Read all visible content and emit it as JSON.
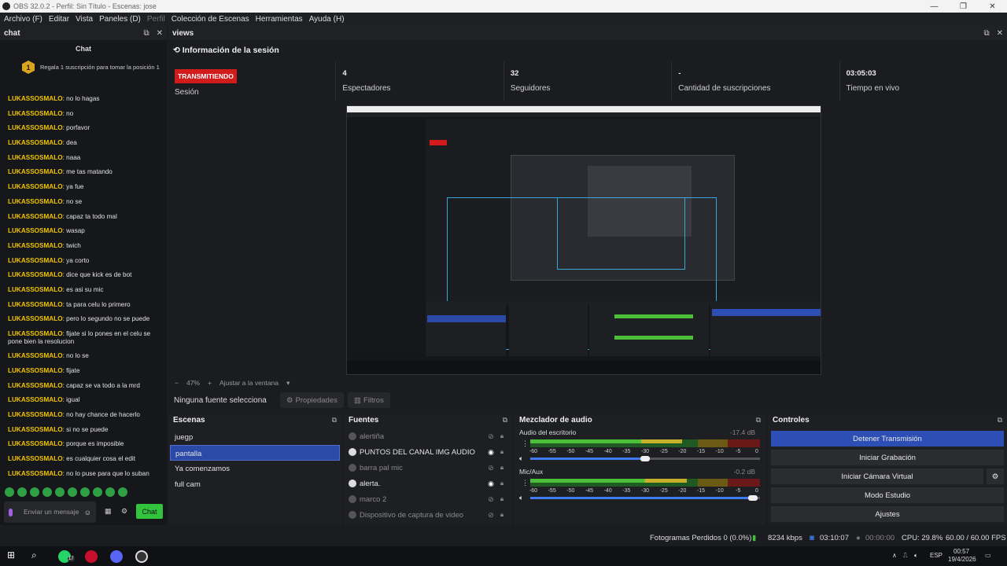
{
  "window": {
    "title": "OBS 32.0.2 - Perfil: Sin Título - Escenas: jose"
  },
  "menu": [
    "Archivo (F)",
    "Editar",
    "Vista",
    "Paneles (D)",
    "Perfil",
    "Colección de Escenas",
    "Herramientas",
    "Ayuda (H)"
  ],
  "chat_dock": {
    "header": "chat",
    "title": "Chat",
    "sub_banner": "Regala 1 suscripción para tomar la posición 1",
    "sub_rank": "1",
    "messages": [
      {
        "user": "LUKASSOSMALO",
        "text": ": no lo hagas"
      },
      {
        "user": "LUKASSOSMALO",
        "text": ": no"
      },
      {
        "user": "LUKASSOSMALO",
        "text": ": porfavor"
      },
      {
        "user": "LUKASSOSMALO",
        "text": ": dea"
      },
      {
        "user": "LUKASSOSMALO",
        "text": ": naaa"
      },
      {
        "user": "LUKASSOSMALO",
        "text": ": me tas matando"
      },
      {
        "user": "LUKASSOSMALO",
        "text": ": ya fue"
      },
      {
        "user": "LUKASSOSMALO",
        "text": ": no se"
      },
      {
        "user": "LUKASSOSMALO",
        "text": ": capaz ta todo mal"
      },
      {
        "user": "LUKASSOSMALO",
        "text": ": wasap"
      },
      {
        "user": "LUKASSOSMALO",
        "text": ": twich"
      },
      {
        "user": "LUKASSOSMALO",
        "text": ": ya corto"
      },
      {
        "user": "LUKASSOSMALO",
        "text": ": dice que kick es de bot"
      },
      {
        "user": "LUKASSOSMALO",
        "text": ": es asi su mic"
      },
      {
        "user": "LUKASSOSMALO",
        "text": ": ta para celu lo primero"
      },
      {
        "user": "LUKASSOSMALO",
        "text": ": pero lo segundo no se puede"
      },
      {
        "user": "LUKASSOSMALO",
        "text": ": fijate si lo pones en el celu se pone bien la resolucion"
      },
      {
        "user": "LUKASSOSMALO",
        "text": ": no lo se"
      },
      {
        "user": "LUKASSOSMALO",
        "text": ": fijate"
      },
      {
        "user": "LUKASSOSMALO",
        "text": ": capaz se va todo a la mrd"
      },
      {
        "user": "LUKASSOSMALO",
        "text": ": igual"
      },
      {
        "user": "LUKASSOSMALO",
        "text": ": no hay chance de hacerlo"
      },
      {
        "user": "LUKASSOSMALO",
        "text": ": si no se puede"
      },
      {
        "user": "LUKASSOSMALO",
        "text": ": porque es imposible"
      },
      {
        "user": "LUKASSOSMALO",
        "text": ": es cualquier cosa el edit"
      },
      {
        "user": "LUKASSOSMALO",
        "text": ": no lo puse para que lo suban"
      }
    ],
    "input_placeholder": "Enviar un mensaje",
    "send_label": "Chat"
  },
  "views_dock": {
    "header": "views",
    "session_title": "Información de la sesión",
    "stats": [
      {
        "value": "TRANSMITIENDO",
        "label": "Sesión"
      },
      {
        "value": "4",
        "label": "Espectadores"
      },
      {
        "value": "32",
        "label": "Seguidores"
      },
      {
        "value": "-",
        "label": "Cantidad de suscripciones"
      },
      {
        "value": "03:05:03",
        "label": "Tiempo en vivo"
      }
    ],
    "zoom": {
      "minus": "−",
      "value": "47%",
      "plus": "+",
      "fit": "Ajustar a la ventana"
    }
  },
  "source_toolbar": {
    "no_source": "Ninguna fuente selecciona",
    "properties": "Propiedades",
    "filters": "Filtros"
  },
  "scenes": {
    "header": "Escenas",
    "items": [
      "juegp",
      "pantalla",
      "Ya comenzamos",
      "full cam"
    ],
    "selected": 1
  },
  "sources": {
    "header": "Fuentes",
    "items": [
      {
        "name": "alertiña",
        "visible": false
      },
      {
        "name": "PUNTOS DEL CANAL IMG AUDIO",
        "visible": true
      },
      {
        "name": "barra pal mic",
        "visible": false
      },
      {
        "name": "alerta.",
        "visible": true
      },
      {
        "name": "marco 2",
        "visible": false
      },
      {
        "name": "Dispositivo de captura de video",
        "visible": false
      }
    ]
  },
  "mixer": {
    "header": "Mezclador de audio",
    "ticks": [
      "-60",
      "-55",
      "-50",
      "-45",
      "-40",
      "-35",
      "-30",
      "-25",
      "-20",
      "-15",
      "-10",
      "-5",
      "0"
    ],
    "channels": [
      {
        "name": "Audio del escritorio",
        "db": "-17.4 dB",
        "level": 0.66,
        "volume": 0.5
      },
      {
        "name": "Mic/Aux",
        "db": "-0.2 dB",
        "level": 0.68,
        "volume": 0.97
      }
    ]
  },
  "controls": {
    "header": "Controles",
    "buttons": [
      "Detener Transmisión",
      "Iniciar Grabación",
      "Iniciar Cámara Virtual",
      "Modo Estudio",
      "Ajustes"
    ]
  },
  "status": {
    "dropped": "Fotogramas Perdidos 0 (0.0%)",
    "kbps": "8234 kbps",
    "stream_time": "03:10:07",
    "rec_time": "00:00:00",
    "cpu": "CPU: 29.8%",
    "fps": "60.00 / 60.00 FPS"
  },
  "taskbar": {
    "lang": "ESP",
    "time": "00:57",
    "date": "19/4/2026",
    "whatsapp_badge": "17"
  },
  "colors": {
    "accent": "#2d4fb5",
    "live": "#d21b1b",
    "chat_user": "#f0c400",
    "chat_send": "#31c43c"
  }
}
